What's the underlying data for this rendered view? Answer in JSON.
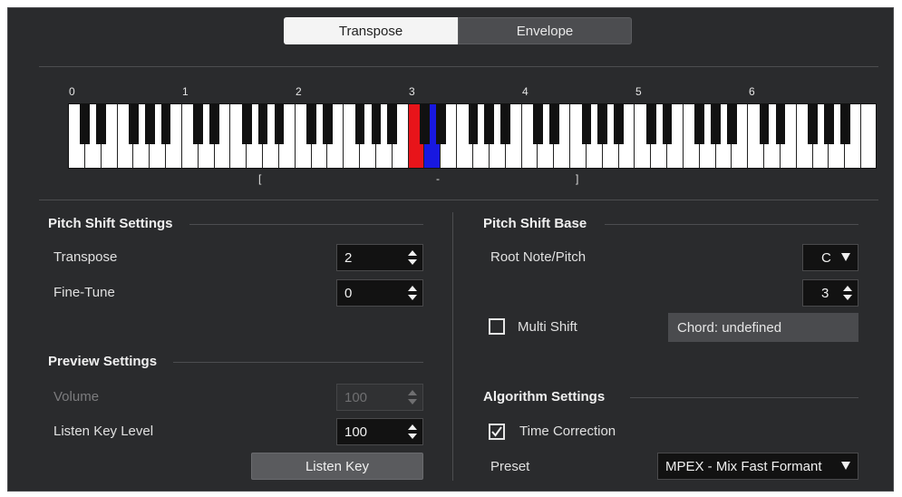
{
  "tabs": [
    {
      "label": "Transpose",
      "active": true
    },
    {
      "label": "Envelope",
      "active": false
    }
  ],
  "keyboard": {
    "octave_labels": [
      "0",
      "1",
      "2",
      "3",
      "4",
      "5",
      "6"
    ],
    "range_start_mark": "[",
    "center_mark": "-",
    "range_end_mark": "]",
    "highlight_colors": {
      "root": "#e8141a",
      "target": "#1818e0"
    }
  },
  "pitch_shift_settings": {
    "title": "Pitch Shift Settings",
    "transpose": {
      "label": "Transpose",
      "value": "2"
    },
    "fine_tune": {
      "label": "Fine-Tune",
      "value": "0"
    }
  },
  "preview_settings": {
    "title": "Preview Settings",
    "volume": {
      "label": "Volume",
      "value": "100"
    },
    "listen_key_level": {
      "label": "Listen Key Level",
      "value": "100"
    },
    "listen_key_button": "Listen Key"
  },
  "pitch_shift_base": {
    "title": "Pitch Shift Base",
    "root_note": {
      "label": "Root Note/Pitch",
      "value": "C"
    },
    "octave": {
      "value": "3"
    },
    "multi_shift": {
      "label": "Multi Shift",
      "checked": false
    },
    "chord": "Chord: undefined"
  },
  "algorithm_settings": {
    "title": "Algorithm Settings",
    "time_correction": {
      "label": "Time Correction",
      "checked": true
    },
    "preset": {
      "label": "Preset",
      "value": "MPEX - Mix Fast Formant"
    }
  },
  "colors": {
    "panel_bg": "#2a2b2d",
    "field_bg": "#121212",
    "accent_text": "#f0f0f0"
  }
}
